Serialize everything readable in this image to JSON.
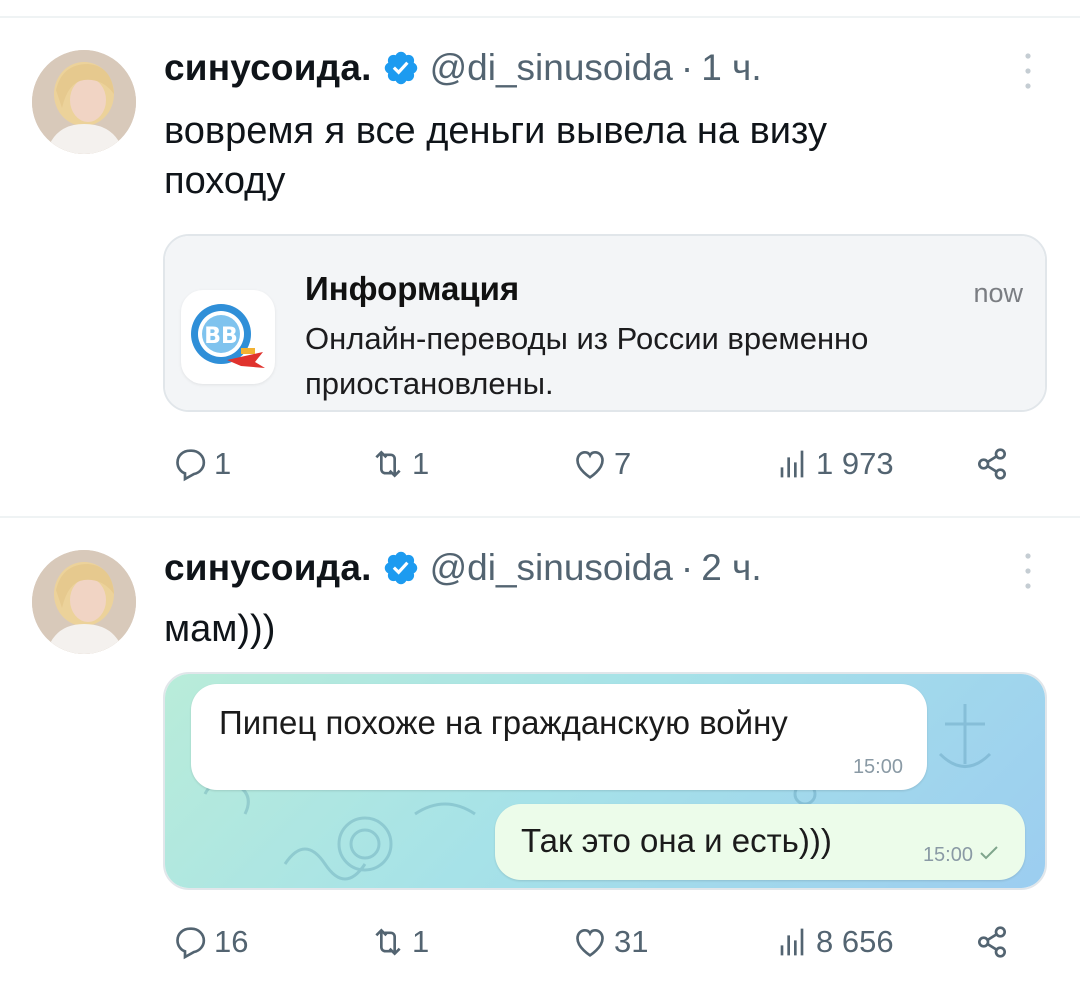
{
  "tweets": [
    {
      "name": "синусоида.",
      "handle": "@di_sinusoida",
      "separator": "·",
      "time": "1 ч.",
      "text_line1": "вовремя я все деньги вывела на визу",
      "text_line2": "походу",
      "card": {
        "type": "notification",
        "title": "Информация",
        "time": "now",
        "body_line1": "Онлайн-переводы из России временно",
        "body_line2": "приостановлены."
      },
      "stats": {
        "replies": "1",
        "retweets": "1",
        "likes": "7",
        "views": "1 973"
      }
    },
    {
      "name": "синусоида.",
      "handle": "@di_sinusoida",
      "separator": "·",
      "time": "2 ч.",
      "text_line1": "мам)))",
      "card": {
        "type": "chat",
        "incoming_text": "Пипец похоже на гражданскую войну",
        "incoming_time": "15:00",
        "outgoing_text": "Так это она и есть)))",
        "outgoing_time": "15:00"
      },
      "stats": {
        "replies": "16",
        "retweets": "1",
        "likes": "31",
        "views": "8 656"
      }
    }
  ],
  "colors": {
    "verified": "#1d9bf0",
    "muted": "#536471",
    "divider": "#eff3f4"
  }
}
